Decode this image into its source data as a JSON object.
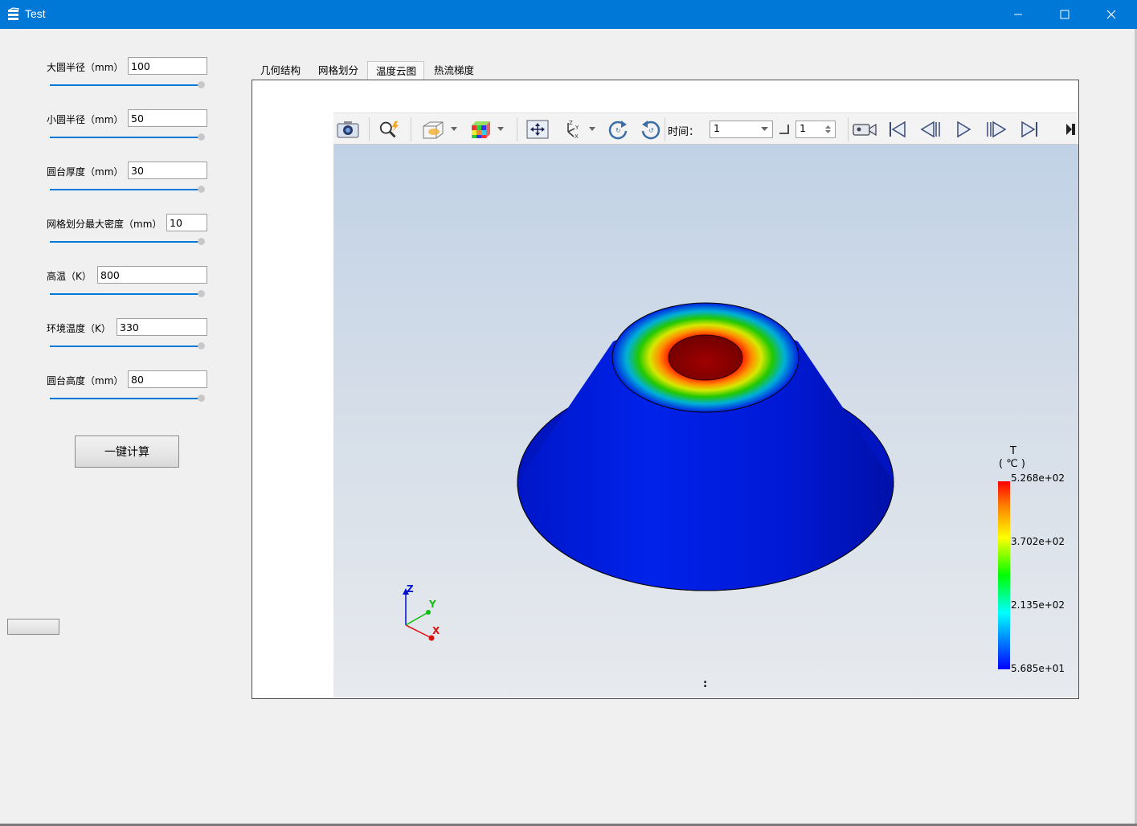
{
  "window": {
    "title": "Test"
  },
  "params": [
    {
      "label": "大圆半径（mm）",
      "value": "100"
    },
    {
      "label": "小圆半径（mm）",
      "value": "50"
    },
    {
      "label": "圆台厚度（mm）",
      "value": "30"
    },
    {
      "label": "网格划分最大密度（mm）",
      "value": "10"
    },
    {
      "label": "高温（K）",
      "value": "800"
    },
    {
      "label": "环境温度（K）",
      "value": "330"
    },
    {
      "label": "圆台高度（mm）",
      "value": "80"
    }
  ],
  "calc_button": {
    "label": "一键计算"
  },
  "tabs": [
    {
      "label": "几何结构"
    },
    {
      "label": "网格划分"
    },
    {
      "label": "温度云图"
    },
    {
      "label": "热流梯度"
    }
  ],
  "active_tab": "温度云图",
  "toolbar": {
    "time_label": "时间：",
    "time_value": "1",
    "step_value": "1",
    "icons": [
      "camera-icon",
      "zoom-icon",
      "box-view-icon",
      "color-cube-icon",
      "fit-view-icon",
      "axes-icon",
      "rotate-cw-icon",
      "rotate-ccw-icon",
      "video-icon",
      "first-frame-icon",
      "prev-frame-icon",
      "play-icon",
      "next-frame-icon",
      "last-frame-icon"
    ]
  },
  "legend": {
    "title": "T",
    "unit": "( ℃ )",
    "values": [
      "5.268e+02",
      "3.702e+02",
      "2.135e+02",
      "5.685e+01"
    ],
    "colors": [
      "#ff0000",
      "#ffff00",
      "#00ff00",
      "#00ffff",
      "#0000ff"
    ]
  },
  "triad": {
    "z": "Z",
    "y": "Y",
    "x": "X"
  },
  "viewport_caption": ":",
  "colors": {
    "titlebar": "#0078d7",
    "slider": "#0078d7",
    "cone": "#0018d8"
  }
}
